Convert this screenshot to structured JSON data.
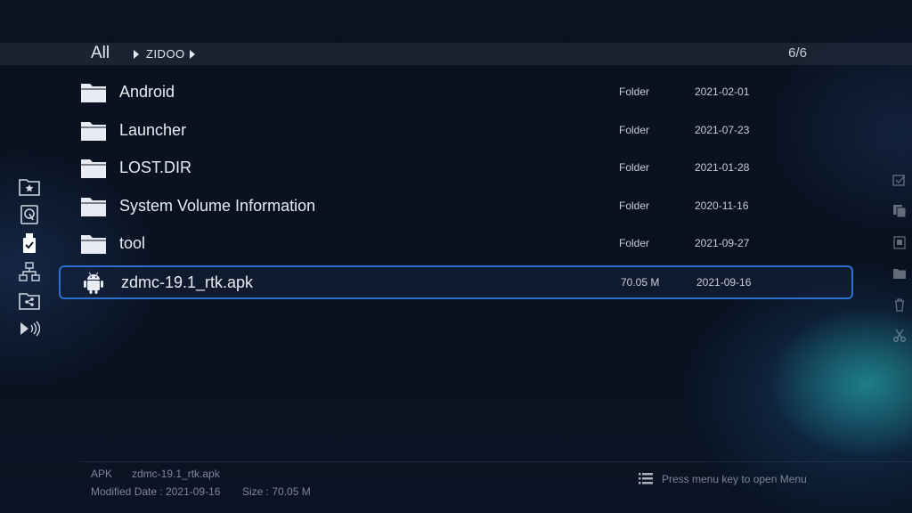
{
  "breadcrumb": {
    "root": "All",
    "folder": "ZIDOO"
  },
  "count": "6/6",
  "sidebar": {
    "items": [
      {
        "icon": "favorites-folder-icon"
      },
      {
        "icon": "hard-disk-icon"
      },
      {
        "icon": "usb-drive-icon"
      },
      {
        "icon": "network-icon"
      },
      {
        "icon": "shared-folder-icon"
      },
      {
        "icon": "media-stream-icon"
      }
    ]
  },
  "right_toolbar": {
    "items": [
      {
        "icon": "select-checkbox-icon"
      },
      {
        "icon": "copy-icon"
      },
      {
        "icon": "paste-icon"
      },
      {
        "icon": "move-folder-icon"
      },
      {
        "icon": "delete-icon"
      },
      {
        "icon": "cut-icon"
      }
    ]
  },
  "files": [
    {
      "name": "Android",
      "type": "Folder",
      "date": "2021-02-01",
      "icon": "folder-icon"
    },
    {
      "name": "Launcher",
      "type": "Folder",
      "date": "2021-07-23",
      "icon": "folder-icon"
    },
    {
      "name": "LOST.DIR",
      "type": "Folder",
      "date": "2021-01-28",
      "icon": "folder-icon"
    },
    {
      "name": "System Volume Information",
      "type": "Folder",
      "date": "2020-11-16",
      "icon": "folder-icon"
    },
    {
      "name": "tool",
      "type": "Folder",
      "date": "2021-09-27",
      "icon": "folder-icon"
    },
    {
      "name": "zdmc-19.1_rtk.apk",
      "type": "70.05 M",
      "date": "2021-09-16",
      "icon": "android-icon",
      "selected": true
    }
  ],
  "details": {
    "kind": "APK",
    "filename": "zdmc-19.1_rtk.apk",
    "modified": "Modified Date : 2021-09-16",
    "size": "Size : 70.05 M"
  },
  "menu_hint": "Press menu key to open Menu",
  "colors": {
    "accent": "#2d6fcf",
    "background": "#0a1322"
  }
}
